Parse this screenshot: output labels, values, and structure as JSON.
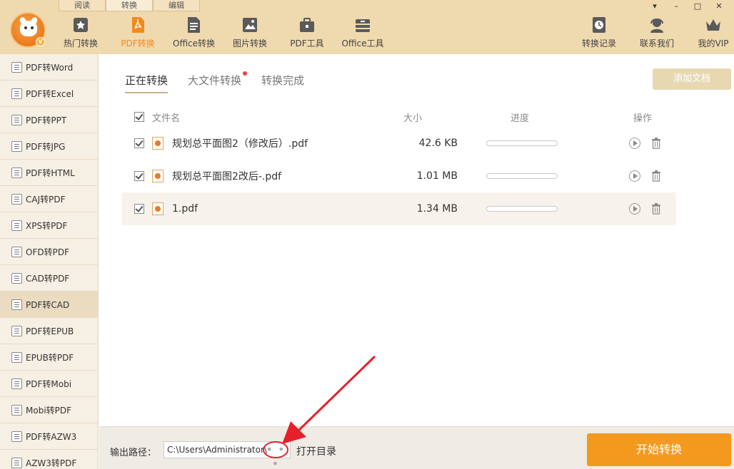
{
  "mode_tabs": [
    "阅读",
    "转换",
    "编辑"
  ],
  "toolbar": {
    "left_tools": [
      {
        "label": "热门转换",
        "icon": "hot-icon"
      },
      {
        "label": "PDF转换",
        "icon": "pdf-icon",
        "active": true
      },
      {
        "label": "Office转换",
        "icon": "office-doc-icon"
      },
      {
        "label": "图片转换",
        "icon": "image-icon"
      },
      {
        "label": "PDF工具",
        "icon": "toolbox-icon"
      },
      {
        "label": "Office工具",
        "icon": "office-toolbox-icon"
      }
    ],
    "right_tools": [
      {
        "label": "转换记录",
        "icon": "history-icon"
      },
      {
        "label": "联系我们",
        "icon": "headset-icon"
      },
      {
        "label": "我的VIP",
        "icon": "crown-icon"
      }
    ]
  },
  "window_buttons": [
    "▾",
    "–",
    "□",
    "✕"
  ],
  "sidebar": {
    "items": [
      {
        "label": "PDF转Word"
      },
      {
        "label": "PDF转Excel"
      },
      {
        "label": "PDF转PPT"
      },
      {
        "label": "PDF转JPG"
      },
      {
        "label": "PDF转HTML"
      },
      {
        "label": "CAJ转PDF"
      },
      {
        "label": "XPS转PDF"
      },
      {
        "label": "OFD转PDF"
      },
      {
        "label": "CAD转PDF"
      },
      {
        "label": "PDF转CAD",
        "active": true
      },
      {
        "label": "PDF转EPUB"
      },
      {
        "label": "EPUB转PDF"
      },
      {
        "label": "PDF转Mobi"
      },
      {
        "label": "Mobi转PDF"
      },
      {
        "label": "PDF转AZW3"
      },
      {
        "label": "AZW3转PDF"
      }
    ]
  },
  "main": {
    "tabs": [
      {
        "label": "正在转换",
        "active": true
      },
      {
        "label": "大文件转换",
        "dot": true
      },
      {
        "label": "转换完成"
      }
    ],
    "add_button": "添加文档",
    "table": {
      "headers": {
        "name": "文件名",
        "size": "大小",
        "progress": "进度",
        "actions": "操作"
      },
      "rows": [
        {
          "name": "规划总平面图2（修改后）.pdf",
          "size": "42.6 KB",
          "progress": 0
        },
        {
          "name": "规划总平面图2改后-.pdf",
          "size": "1.01 MB",
          "progress": 0
        },
        {
          "name": "1.pdf",
          "size": "1.34 MB",
          "progress": 0
        }
      ]
    }
  },
  "bottom": {
    "output_label": "输出路径：",
    "output_path": "C:\\Users\\Administrator\\",
    "more_button": "• • •",
    "open_dir": "打开目录",
    "start_button": "开始转换"
  },
  "colors": {
    "header_bg": "#efd9ae",
    "accent": "#f08a1e",
    "start_button": "#f39a1e",
    "annotation_red": "#e6202a"
  }
}
